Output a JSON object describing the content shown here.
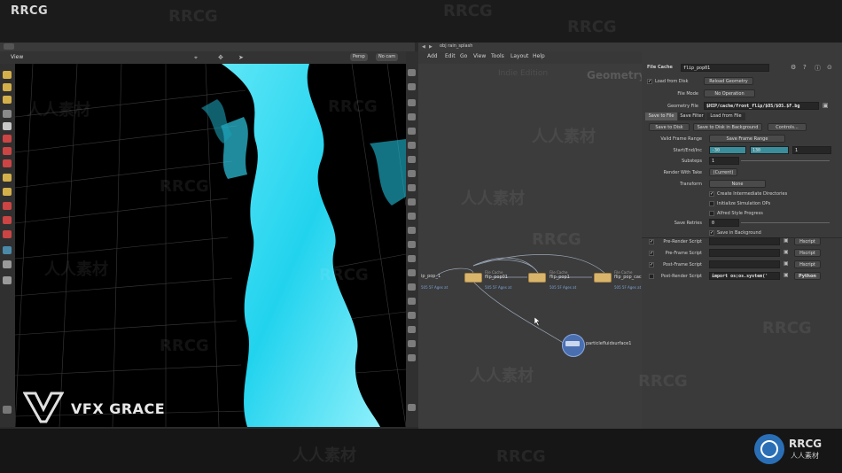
{
  "brand": "RRCG",
  "colors": {
    "water": "#22d3ee",
    "node": "#d9b56c",
    "accent_blue": "#7aa2d6",
    "field_teal": "#3a8d9a"
  },
  "viewport": {
    "tab_label": "View",
    "persp_label": "Persp",
    "cam_label": "No cam"
  },
  "network": {
    "path": "obj  rain_splash",
    "menu": [
      "Add",
      "Edit",
      "Go",
      "View",
      "Tools",
      "Layout",
      "Help"
    ],
    "edition_watermark": "Indie Edition",
    "context_label": "Geometry",
    "nodes": [
      {
        "label": "ip_pop_1",
        "sub": "505 5F Ages at"
      },
      {
        "label": "flip_pop01",
        "type": "File Cache",
        "sub": "505 5F Ages at"
      },
      {
        "label": "flip_pop1",
        "type": "File Cache",
        "sub": "505 5F Ages at"
      },
      {
        "label": "flip_pop_cac",
        "type": "File Cache",
        "sub": "505 5F Ages at"
      }
    ],
    "surface_node": {
      "label": "particlefluidsurface1"
    }
  },
  "params": {
    "node_type": "File Cache",
    "node_name": "flip_pop01",
    "load_from_disk": "Load from Disk",
    "reload_geometry": "Reload Geometry",
    "file_mode_label": "File Mode",
    "file_mode_value": "No Operation",
    "geometry_file_label": "Geometry File",
    "geometry_file_value": "$HIP/cache/front_flip/$OS/$OS.$F.bg",
    "tabs": [
      "Save to File",
      "Save Filter",
      "Load from File"
    ],
    "save_to_disk": "Save to Disk",
    "save_bg": "Save to Disk in Background",
    "controls": "Controls...",
    "valid_frame_range_label": "Valid Frame Range",
    "valid_frame_range_value": "Save Frame Range",
    "start_end_label": "Start/End/Inc",
    "start_value": "-30",
    "end_value": "130",
    "inc_value": "1",
    "substeps_label": "Substeps",
    "substeps_value": "1",
    "render_with_take_label": "Render With Take",
    "render_with_take_value": "(Current)",
    "transform_label": "Transform",
    "transform_value": "None",
    "create_dirs": "Create Intermediate Directories",
    "init_sim": "Initialize Simulation OPs",
    "alfred": "Alfred Style Progress",
    "save_retries_label": "Save Retries",
    "save_retries_value": "0",
    "save_in_bg": "Save in Background",
    "pre_render": "Pre-Render Script",
    "pre_frame": "Pre-Frame Script",
    "post_frame": "Post-Frame Script",
    "post_render": "Post-Render Script",
    "script_lang": "Hscript",
    "post_render_value": "import os;os.system('",
    "post_render_lang": "Python"
  },
  "watermarks": [
    "RRCG",
    "人人素材"
  ],
  "footer": {
    "vfx_grace": "VFX GRACE",
    "logo_text": "RRCG",
    "logo_sub": "人人素材"
  }
}
